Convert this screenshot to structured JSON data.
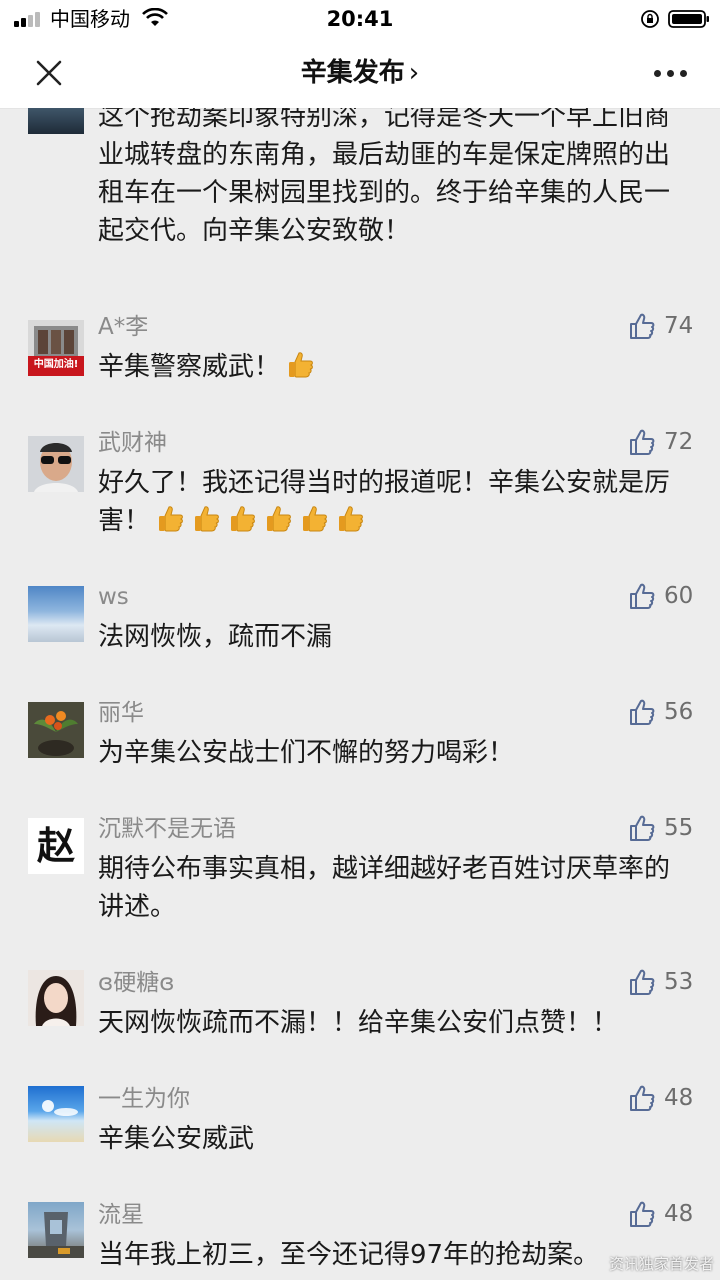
{
  "status_bar": {
    "carrier": "中国移动",
    "time": "20:41"
  },
  "nav": {
    "title": "辛集发布",
    "chevron": "›"
  },
  "comments": [
    {
      "name": "",
      "text": "这个抢劫案印象特别深，记得是冬天一个早上旧商业城转盘的东南角，最后劫匪的车是保定牌照的出租车在一个果树园里找到的。终于给辛集的人民一起交代。向辛集公安致敬！",
      "likes": ""
    },
    {
      "name": "A*李",
      "avatar_caption": "中国加油!",
      "text": "辛集警察威武！",
      "thumbs": 1,
      "likes": "74"
    },
    {
      "name": "武财神",
      "text": "好久了！我还记得当时的报道呢！辛集公安就是厉害！",
      "thumbs": 6,
      "likes": "72"
    },
    {
      "name": "ws",
      "text": "法网恢恢，疏而不漏",
      "likes": "60"
    },
    {
      "name": "丽华",
      "text": "为辛集公安战士们不懈的努力喝彩！",
      "likes": "56"
    },
    {
      "name": "沉默不是无语",
      "avatar_glyph": "赵",
      "text": "期待公布事实真相，越详细越好老百姓讨厌草率的讲述。",
      "likes": "55"
    },
    {
      "name": "ɞ硬糖ɞ",
      "text": "天网恢恢疏而不漏！！给辛集公安们点赞！！",
      "likes": "53"
    },
    {
      "name": "一生为你",
      "text": "辛集公安威武",
      "likes": "48"
    },
    {
      "name": "流星",
      "text": "当年我上初三，至今还记得97年的抢劫案。",
      "likes": "48"
    }
  ],
  "watermark": "资讯独家首发者",
  "icons": {
    "close": "close-icon",
    "more": "more-icon",
    "like": "thumbs-up-outline-icon",
    "emoji": "thumbs-up-emoji-icon"
  },
  "colors": {
    "background": "#ededed",
    "name_text": "#8a8a8a",
    "body_text": "#1a1a1a",
    "like_icon": "#576b95"
  }
}
